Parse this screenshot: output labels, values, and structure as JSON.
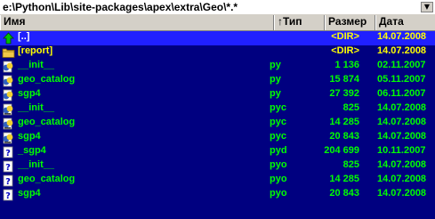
{
  "path": "e:\\Python\\Lib\\site-packages\\apex\\extra\\Geo\\*.*",
  "path_button": "▼",
  "columns": {
    "name": "Имя",
    "type": "↑Тип",
    "size": "Размер",
    "date": "Дата"
  },
  "colors": {
    "panel_bg": "#000080",
    "selected_bg": "#2020ff",
    "dir_text": "#ffff00",
    "file_text": "#00ff00",
    "selected_text": "#ffffff"
  },
  "rows": [
    {
      "icon": "up-arrow-icon",
      "name": "[..]",
      "ext": "",
      "size": "<DIR>",
      "date": "14.07.2008",
      "selected": true,
      "kind": "parent"
    },
    {
      "icon": "folder-icon",
      "name": "[report]",
      "ext": "",
      "size": "<DIR>",
      "date": "14.07.2008",
      "selected": false,
      "kind": "dir"
    },
    {
      "icon": "python-icon",
      "name": "__init__",
      "ext": "py",
      "size": "1 136",
      "date": "02.11.2007",
      "selected": false,
      "kind": "file"
    },
    {
      "icon": "python-icon",
      "name": "geo_catalog",
      "ext": "py",
      "size": "15 874",
      "date": "05.11.2007",
      "selected": false,
      "kind": "file"
    },
    {
      "icon": "python-icon",
      "name": "sgp4",
      "ext": "py",
      "size": "27 392",
      "date": "06.11.2007",
      "selected": false,
      "kind": "file"
    },
    {
      "icon": "python-compiled-icon",
      "name": "__init__",
      "ext": "pyc",
      "size": "825",
      "date": "14.07.2008",
      "selected": false,
      "kind": "file"
    },
    {
      "icon": "python-compiled-icon",
      "name": "geo_catalog",
      "ext": "pyc",
      "size": "14 285",
      "date": "14.07.2008",
      "selected": false,
      "kind": "file"
    },
    {
      "icon": "python-compiled-icon",
      "name": "sgp4",
      "ext": "pyc",
      "size": "20 843",
      "date": "14.07.2008",
      "selected": false,
      "kind": "file"
    },
    {
      "icon": "unknown-file-icon",
      "name": "_sgp4",
      "ext": "pyd",
      "size": "204 699",
      "date": "10.11.2007",
      "selected": false,
      "kind": "file"
    },
    {
      "icon": "unknown-file-icon",
      "name": "__init__",
      "ext": "pyo",
      "size": "825",
      "date": "14.07.2008",
      "selected": false,
      "kind": "file"
    },
    {
      "icon": "unknown-file-icon",
      "name": "geo_catalog",
      "ext": "pyo",
      "size": "14 285",
      "date": "14.07.2008",
      "selected": false,
      "kind": "file"
    },
    {
      "icon": "unknown-file-icon",
      "name": "sgp4",
      "ext": "pyo",
      "size": "20 843",
      "date": "14.07.2008",
      "selected": false,
      "kind": "file"
    }
  ]
}
